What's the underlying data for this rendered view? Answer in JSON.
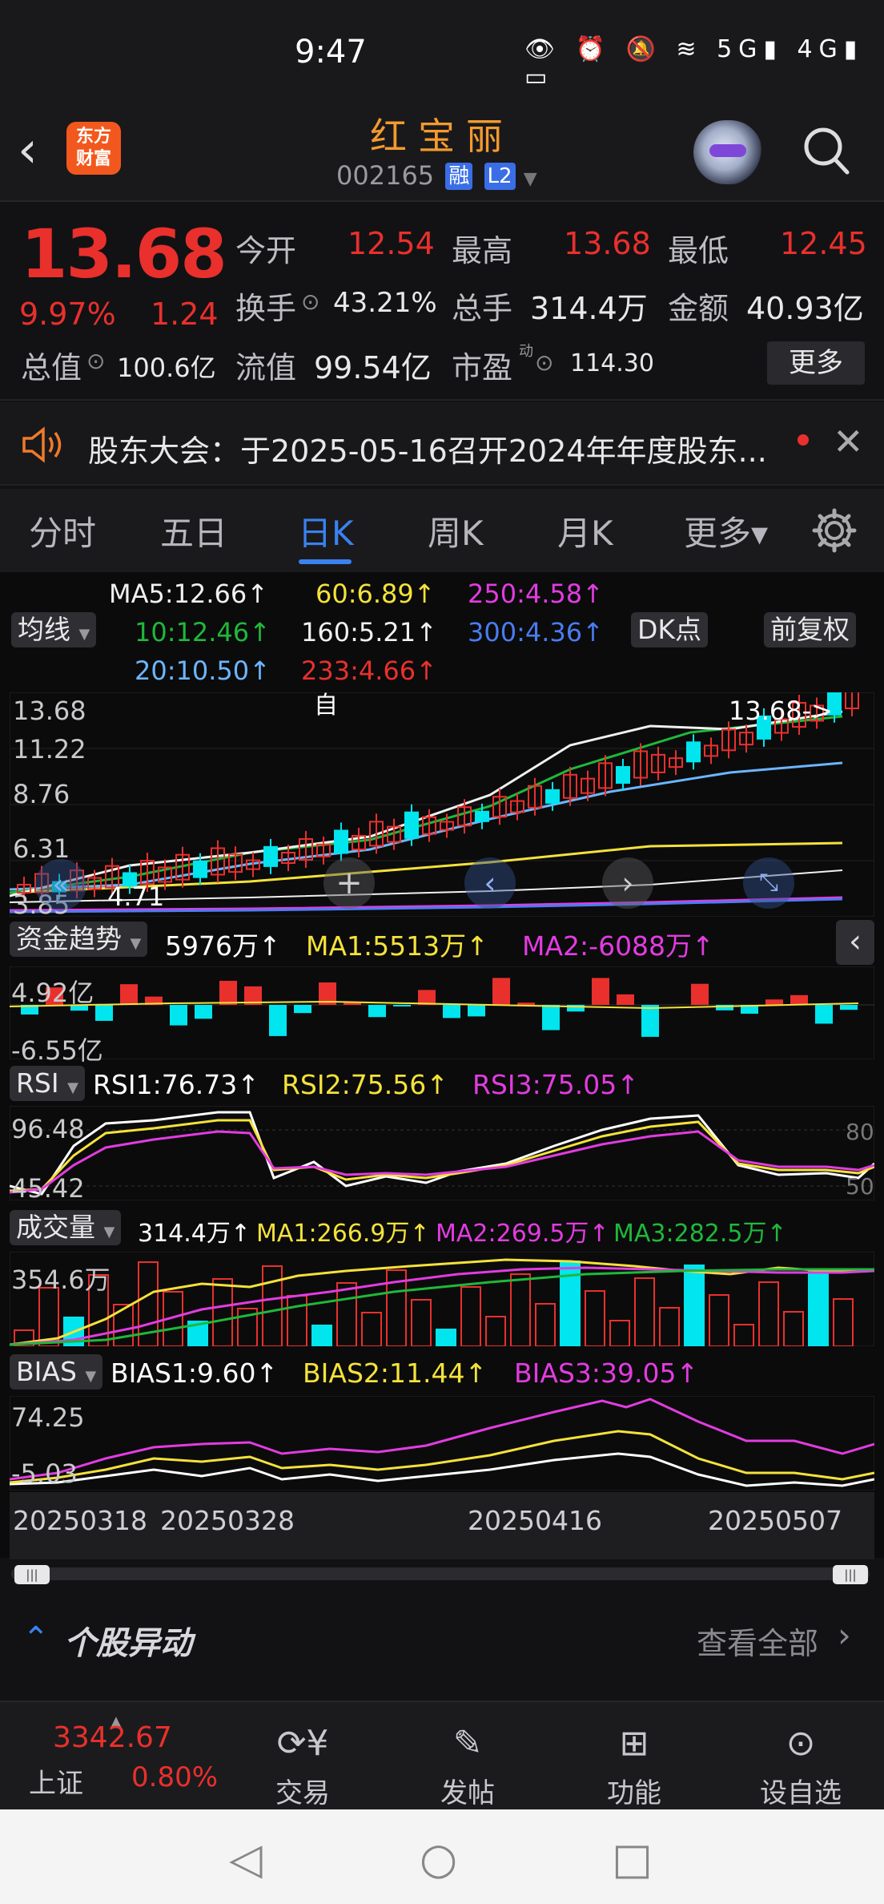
{
  "status": {
    "time": "9:47",
    "icons": "👁 ⏰ 🔕 ≋ 5G▮ 4G▮ ▭"
  },
  "header": {
    "title": "红宝丽",
    "code": "002165",
    "badge1": "融",
    "badge2": "L2",
    "logo_line1": "东方",
    "logo_line2": "财富"
  },
  "quote": {
    "price": "13.68",
    "pct": "9.97%",
    "change": "1.24",
    "open_label": "今开",
    "open": "12.54",
    "high_label": "最高",
    "high": "13.68",
    "low_label": "最低",
    "low": "12.45",
    "turnover_label": "换手",
    "turnover": "43.21%",
    "vol_label": "总手",
    "vol": "314.4万",
    "amount_label": "金额",
    "amount": "40.93亿",
    "mcap_label": "总值",
    "mcap": "100.6亿",
    "float_label": "流值",
    "float": "99.54亿",
    "pe_label": "市盈",
    "pe_sup": "动",
    "pe": "114.30",
    "more": "更多"
  },
  "notice": {
    "text": "股东大会：于2025-05-16召开2024年年度股东..."
  },
  "tabs": [
    "分时",
    "五日",
    "日K",
    "周K",
    "月K",
    "更多▾"
  ],
  "ma": {
    "ma5": "MA5:12.66↑",
    "ma10": "10:12.46↑",
    "ma20": "20:10.50↑",
    "ma60": "60:6.89↑",
    "ma160": "160:5.21↑",
    "ma233": "233:4.66↑",
    "ma250": "250:4.58↑",
    "ma300": "300:4.36↑",
    "avg_btn": "均线",
    "dk_btn": "DK点",
    "fq_btn": "前复权"
  },
  "price_axis": {
    "top": "13.68",
    "a": "11.22",
    "b": "8.76",
    "c": "6.31",
    "bottom": "3.85",
    "last": "13.68->",
    "low_mark": "4.71",
    "self": "自"
  },
  "fund": {
    "chip": "资金趋势",
    "v": "5976万↑",
    "ma1": "MA1:5513万↑",
    "ma2": "MA2:-6088万↑",
    "top": "4.92亿",
    "bottom": "-6.55亿"
  },
  "rsi": {
    "chip": "RSI",
    "r1": "RSI1:76.73↑",
    "r2": "RSI2:75.56↑",
    "r3": "RSI3:75.05↑",
    "top": "96.48",
    "bottom": "45.42",
    "r80": "80",
    "r50": "50"
  },
  "volume": {
    "chip": "成交量",
    "v": "314.4万↑",
    "ma1": "MA1:266.9万↑",
    "ma2": "MA2:269.5万↑",
    "ma3": "MA3:282.5万↑",
    "top": "354.6万"
  },
  "bias": {
    "chip": "BIAS",
    "b1": "BIAS1:9.60↑",
    "b2": "BIAS2:11.44↑",
    "b3": "BIAS3:39.05↑",
    "top": "74.25",
    "bottom": "-5.03"
  },
  "dates": [
    "20250318",
    "20250328",
    "20250416",
    "20250507"
  ],
  "news": {
    "title": "个股异动",
    "link": "查看全部"
  },
  "bottom": {
    "index_val": "3342.67",
    "index_name": "上证",
    "index_pct": "0.80%",
    "trade": "交易",
    "post": "发帖",
    "func": "功能",
    "watch": "设自选"
  },
  "colors": {
    "up": "#e9302c",
    "down": "#00e5ee",
    "accent": "#3a82f0",
    "brand": "#f39a2e",
    "yellow": "#f4e23a",
    "magenta": "#e23ce0",
    "green": "#1fb83a"
  }
}
